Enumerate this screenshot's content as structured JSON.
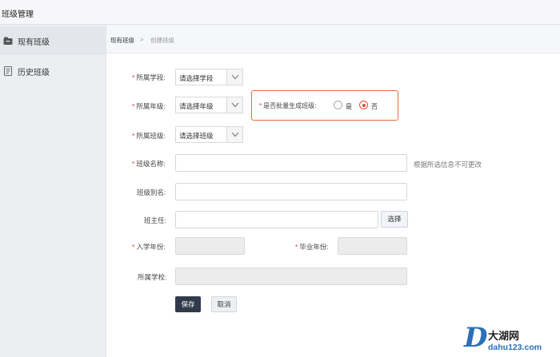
{
  "app_title": "班级管理",
  "sidebar": {
    "items": [
      {
        "label": "现有班级",
        "icon": "folder-icon",
        "active": true
      },
      {
        "label": "历史班级",
        "icon": "archive-icon",
        "active": false
      }
    ]
  },
  "breadcrumb": {
    "home": "现有班级",
    "separator": ">",
    "current": "创建班级"
  },
  "form": {
    "stage": {
      "required_mark": "*",
      "label": "所属学段:",
      "value": "请选择学段"
    },
    "grade": {
      "required_mark": "*",
      "label": "所属年级:",
      "value": "请选择年级"
    },
    "batch": {
      "required_mark": "*",
      "label": "是否批量生成班级:",
      "option_yes": "是",
      "option_no": "否",
      "selected": "否"
    },
    "class": {
      "required_mark": "*",
      "label": "所属班级:",
      "value": "请选择班级"
    },
    "class_name": {
      "required_mark": "*",
      "label": "班级名称:",
      "value": "",
      "hint": "根据所选信息不可更改"
    },
    "alias": {
      "label": "班级别名:",
      "value": ""
    },
    "teacher": {
      "label": "班主任:",
      "value": "",
      "button": "选择"
    },
    "enroll_year": {
      "required_mark": "*",
      "label": "入学年份:",
      "value": ""
    },
    "grad_year": {
      "required_mark": "*",
      "label": "毕业年份:",
      "value": ""
    },
    "school": {
      "label": "所属学校:",
      "value": ""
    }
  },
  "actions": {
    "save": "保存",
    "cancel": "取消"
  },
  "watermark": {
    "letter": "D",
    "name": "大湖网",
    "url": "dahu123.com"
  },
  "colors": {
    "required": "#e4393c",
    "highlight_border": "#e8683e",
    "save_button": "#2f3a4a",
    "radio_checked": "#e74c3c"
  }
}
